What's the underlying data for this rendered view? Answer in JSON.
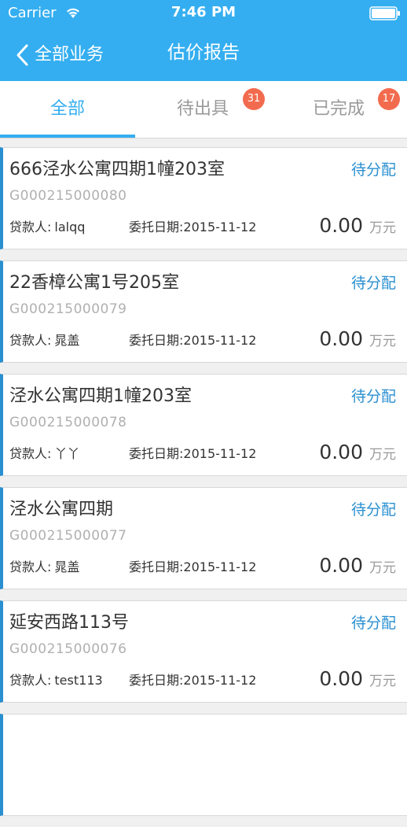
{
  "status_bar": {
    "carrier": "Carrier",
    "time": "7:46 PM",
    "wifi_icon": "wifi-icon",
    "battery_icon": "battery-icon"
  },
  "nav": {
    "back_label": "全部业务",
    "back_icon": "chevron-left-icon",
    "title": "估价报告"
  },
  "tabs": [
    {
      "label": "全部",
      "active": true,
      "badge": ""
    },
    {
      "label": "待出具",
      "active": false,
      "badge": "31"
    },
    {
      "label": "已完成",
      "active": false,
      "badge": "17"
    }
  ],
  "colors": {
    "header": "#34aef0",
    "accent": "#34aef0",
    "status_text": "#2a8fd0",
    "badge": "#f26b4e",
    "card_border": "#2a8fd0"
  },
  "labels": {
    "borrower": "贷款人:",
    "entrust_date": "委托日期:",
    "unit": "万元"
  },
  "reports": [
    {
      "title": "666泾水公寓四期1幢203室",
      "code": "G000215000080",
      "status": "待分配",
      "borrower": "lalqq",
      "date": "2015-11-12",
      "amount": "0.00"
    },
    {
      "title": "22香樟公寓1号205室",
      "code": "G000215000079",
      "status": "待分配",
      "borrower": "晁盖",
      "date": "2015-11-12",
      "amount": "0.00"
    },
    {
      "title": "泾水公寓四期1幢203室",
      "code": "G000215000078",
      "status": "待分配",
      "borrower": "丫丫",
      "date": "2015-11-12",
      "amount": "0.00"
    },
    {
      "title": "泾水公寓四期",
      "code": "G000215000077",
      "status": "待分配",
      "borrower": "晁盖",
      "date": "2015-11-12",
      "amount": "0.00"
    },
    {
      "title": "延安西路113号",
      "code": "G000215000076",
      "status": "待分配",
      "borrower": "test113",
      "date": "2015-11-12",
      "amount": "0.00"
    }
  ]
}
